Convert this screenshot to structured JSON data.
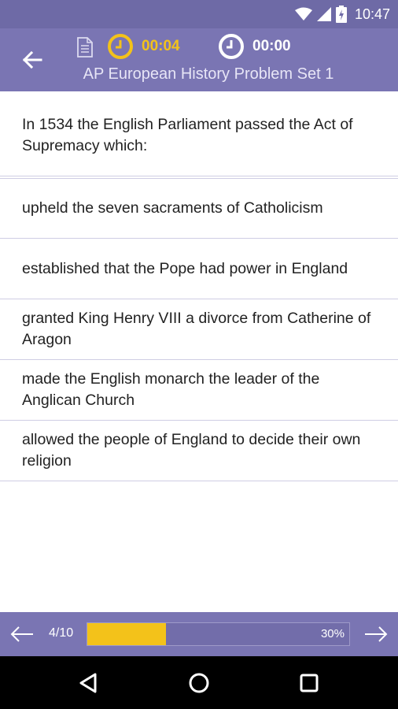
{
  "status_bar": {
    "time": "10:47",
    "icons": [
      "wifi-icon",
      "signal-icon",
      "battery-charging-icon"
    ]
  },
  "header": {
    "back_icon": "arrow-left-icon",
    "document_icon": "document-icon",
    "timer_question": "00:04",
    "timer_total": "00:00",
    "title": "AP European History Problem Set 1",
    "accent_color": "#f3c21a",
    "bar_color": "#7a75b3"
  },
  "question": {
    "text": "In 1534 the English Parliament passed the Act of Supremacy which:"
  },
  "answers": [
    "upheld the seven sacraments of Catholicism",
    "established that the Pope had power in England",
    "granted King Henry VIII a divorce from Catherine of Aragon",
    "made the English monarch the leader of the Anglican Church",
    "allowed the people of England to decide their own religion"
  ],
  "footer": {
    "counter": "4/10",
    "progress_percent_label": "30%",
    "progress_fraction": 0.3
  },
  "nav": {
    "icons": [
      "back-triangle-icon",
      "home-circle-icon",
      "recents-square-icon"
    ]
  }
}
